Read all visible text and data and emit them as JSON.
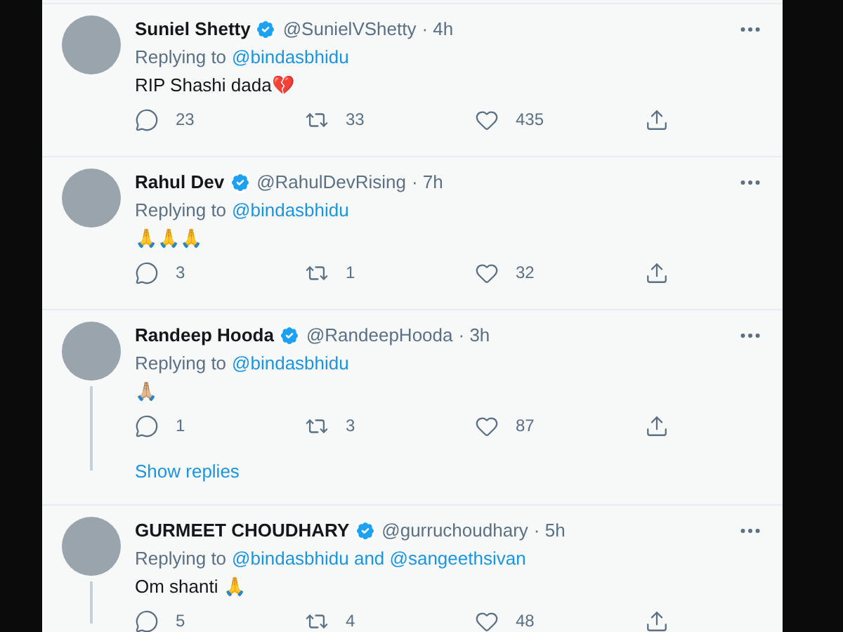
{
  "tweets": [
    {
      "name": "Suniel Shetty",
      "verified": true,
      "handle": "@SunielVShetty",
      "time": "· 4h",
      "replying_label": "Replying to",
      "replying_to": "@bindasbhidu",
      "text": "RIP Shashi dada💔",
      "replies": "23",
      "retweets": "33",
      "likes": "435",
      "thread": false
    },
    {
      "name": "Rahul Dev",
      "verified": true,
      "handle": "@RahulDevRising",
      "time": "· 7h",
      "replying_label": "Replying to",
      "replying_to": "@bindasbhidu",
      "text": "🙏🙏🙏",
      "replies": "3",
      "retweets": "1",
      "likes": "32",
      "thread": false
    },
    {
      "name": "Randeep Hooda",
      "verified": true,
      "handle": "@RandeepHooda",
      "time": "· 3h",
      "replying_label": "Replying to",
      "replying_to": "@bindasbhidu",
      "text": "🙏🏼",
      "replies": "1",
      "retweets": "3",
      "likes": "87",
      "thread": true,
      "show_replies": "Show replies"
    },
    {
      "name": "GURMEET CHOUDHARY",
      "verified": true,
      "handle": "@gurruchoudhary",
      "time": "· 5h",
      "replying_label": "Replying to",
      "replying_to": "@bindasbhidu and @sangeethsivan",
      "text": "Om shanti 🙏",
      "replies": "5",
      "retweets": "4",
      "likes": "48",
      "thread": true
    }
  ]
}
